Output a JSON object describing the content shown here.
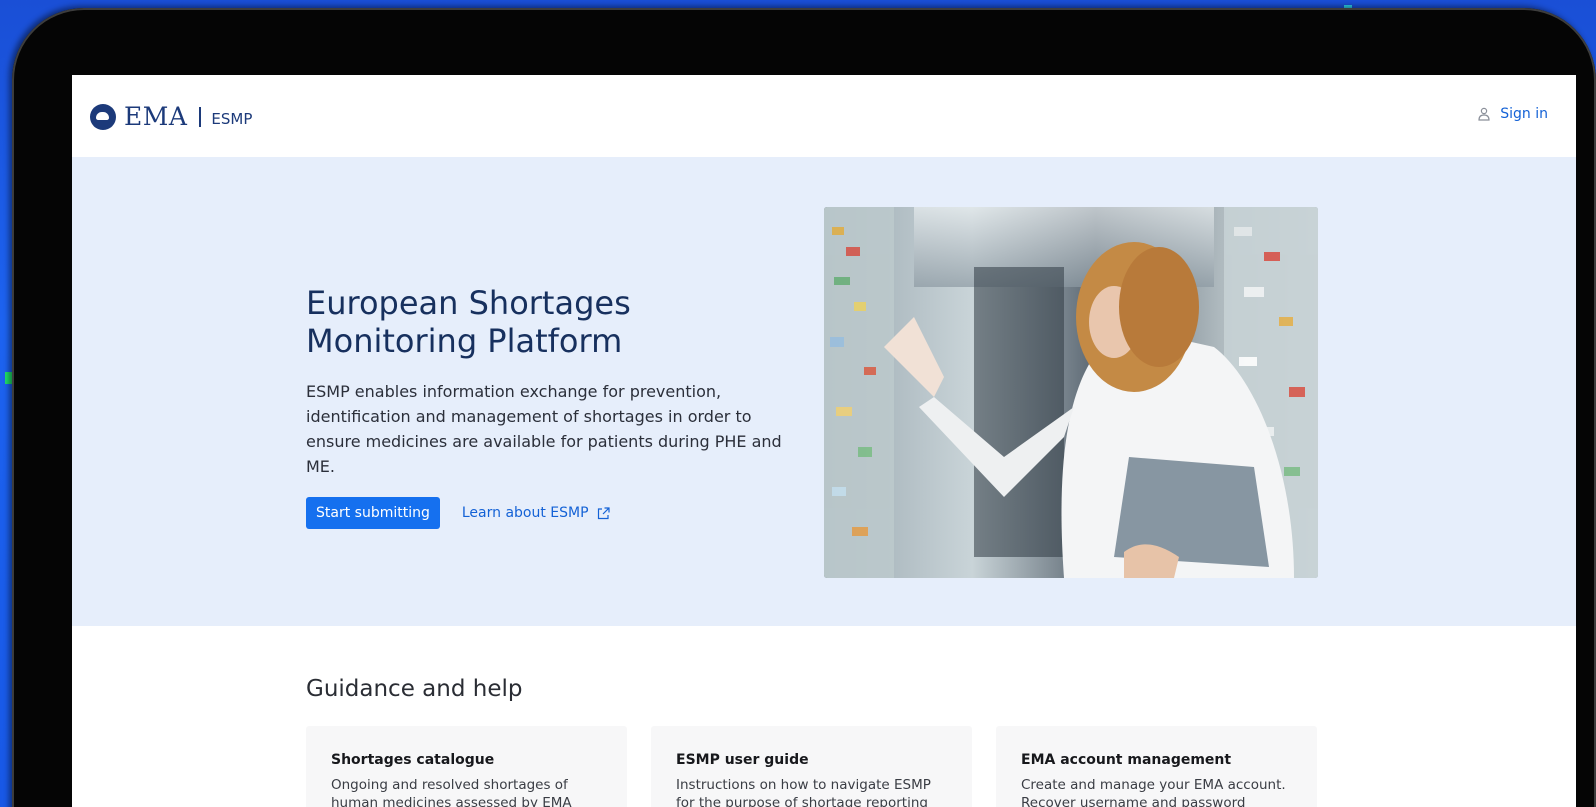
{
  "header": {
    "logo_text": "EMA",
    "logo_sub": "ESMP",
    "signin_label": "Sign in",
    "icons": {
      "logo": "ema-logo-icon",
      "user": "user-icon"
    }
  },
  "hero": {
    "title_line1": "European Shortages",
    "title_line2": "Monitoring Platform",
    "description": "ESMP enables information exchange for prevention, identification and management of shortages in order to ensure medicines are available for patients during PHE and ME.",
    "primary_button": "Start submitting",
    "secondary_link": "Learn about ESMP",
    "icons": {
      "external": "external-link-icon"
    },
    "photo": "pharmacist-with-tablet-photo"
  },
  "guidance": {
    "title": "Guidance and help",
    "cards": [
      {
        "title": "Shortages catalogue",
        "description": "Ongoing and resolved shortages of human medicines assessed by EMA"
      },
      {
        "title": "ESMP user guide",
        "description": "Instructions on how to navigate ESMP for the purpose of shortage reporting"
      },
      {
        "title": "EMA account management",
        "description": "Create and manage your EMA account. Recover username and password"
      }
    ]
  },
  "colors": {
    "brand": "#1c3a7a",
    "primary": "#1570ef",
    "link": "#1462d6",
    "hero_bg": "#e6eefb",
    "background": "#1d63f0"
  }
}
